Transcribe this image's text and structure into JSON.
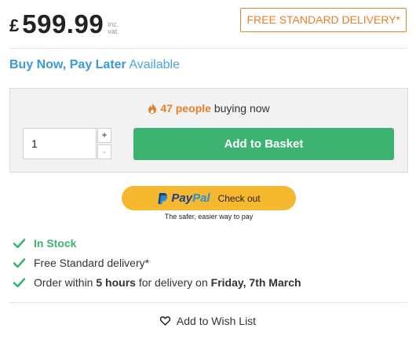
{
  "price": {
    "currency": "£",
    "amount": "599.99",
    "inc_label": "inc.",
    "vat_label": "vat"
  },
  "delivery_badge": "FREE STANDARD DELIVERY*",
  "bnpl": {
    "strong": "Buy Now, Pay Later",
    "available": "Available"
  },
  "buying_now": {
    "count": "47 people",
    "suffix": "buying now",
    "icon": "flame-icon"
  },
  "quantity": {
    "value": "1",
    "plus": "+",
    "minus": "-"
  },
  "add_to_basket": "Add to Basket",
  "paypal": {
    "pay": "Pay",
    "pal": "Pal",
    "checkout": "Check out",
    "tagline": "The safer, easier way to pay"
  },
  "features": {
    "stock": "In Stock",
    "free_delivery": "Free Standard delivery*",
    "order_prefix": "Order within",
    "order_hours": "5 hours",
    "order_middle": "for delivery on",
    "order_date": "Friday, 7th March"
  },
  "wishlist": "Add to Wish List",
  "colors": {
    "accent_orange": "#e8802a",
    "link_blue": "#3a9ad8",
    "green": "#3cb371",
    "paypal_yellow": "#f5b82e"
  }
}
